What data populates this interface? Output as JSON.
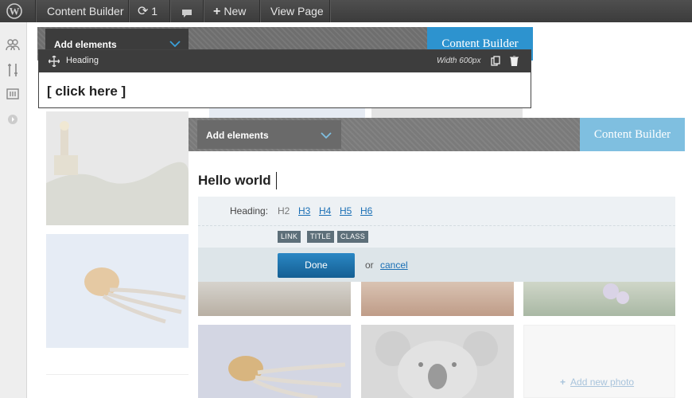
{
  "admin_bar": {
    "wp_logo": "wordpress-logo",
    "site_name": "Content Builder",
    "updates_count": "1",
    "new_label": "New",
    "view_page_label": "View Page"
  },
  "top_editor": {
    "add_elements_label": "Add elements",
    "content_builder_label": "Content Builder",
    "element_type_label": "Heading",
    "width_label": "Width 600px",
    "placeholder_text": "[ click here ]"
  },
  "main_editor": {
    "add_elements_label": "Add elements",
    "content_builder_label": "Content Builder",
    "heading_text": "Hello world",
    "heading_field_label": "Heading:",
    "heading_levels": [
      "H2",
      "H3",
      "H4",
      "H5",
      "H6"
    ],
    "tags": [
      "LINK",
      "TITLE",
      "CLASS"
    ],
    "done_label": "Done",
    "or_label": "or",
    "cancel_label": "cancel"
  },
  "gallery": {
    "add_photo_label": "Add new photo"
  },
  "colors": {
    "admin_bar": "#464646",
    "content_builder_blue": "#2d93cf",
    "content_builder_light": "#7fbfe0",
    "done_button": "#1d6fa5"
  }
}
